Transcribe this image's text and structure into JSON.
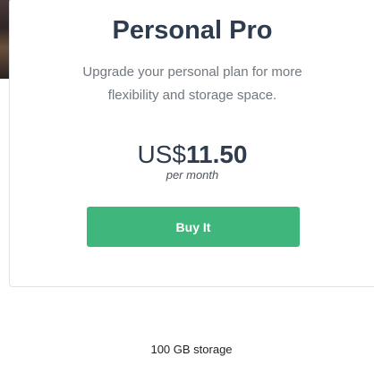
{
  "plan": {
    "title": "Personal Pro",
    "description": "Upgrade your personal plan for more flexibility and storage space.",
    "currency": "US$",
    "amount": "11.50",
    "period": "per month",
    "buy_label": "Buy It"
  },
  "features": {
    "storage": "100 GB storage"
  },
  "colors": {
    "title": "#2e3c4d",
    "button": "#3fb67c",
    "description": "#72787e"
  }
}
